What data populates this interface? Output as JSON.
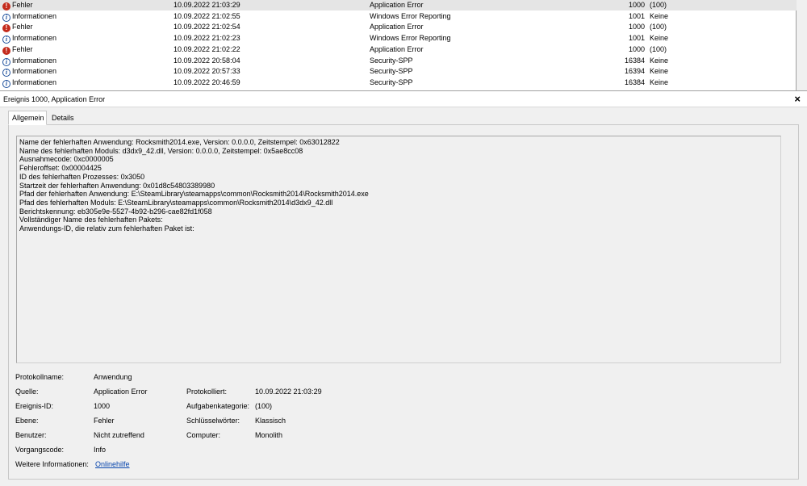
{
  "events": [
    {
      "level": "Fehler",
      "level_type": "error",
      "date": "10.09.2022 21:03:29",
      "source": "Application Error",
      "id": "1000",
      "task": "(100)",
      "selected": true
    },
    {
      "level": "Informationen",
      "level_type": "info",
      "date": "10.09.2022 21:02:55",
      "source": "Windows Error Reporting",
      "id": "1001",
      "task": "Keine"
    },
    {
      "level": "Fehler",
      "level_type": "error",
      "date": "10.09.2022 21:02:54",
      "source": "Application Error",
      "id": "1000",
      "task": "(100)"
    },
    {
      "level": "Informationen",
      "level_type": "info",
      "date": "10.09.2022 21:02:23",
      "source": "Windows Error Reporting",
      "id": "1001",
      "task": "Keine"
    },
    {
      "level": "Fehler",
      "level_type": "error",
      "date": "10.09.2022 21:02:22",
      "source": "Application Error",
      "id": "1000",
      "task": "(100)"
    },
    {
      "level": "Informationen",
      "level_type": "info",
      "date": "10.09.2022 20:58:04",
      "source": "Security-SPP",
      "id": "16384",
      "task": "Keine"
    },
    {
      "level": "Informationen",
      "level_type": "info",
      "date": "10.09.2022 20:57:33",
      "source": "Security-SPP",
      "id": "16394",
      "task": "Keine"
    },
    {
      "level": "Informationen",
      "level_type": "info",
      "date": "10.09.2022 20:46:59",
      "source": "Security-SPP",
      "id": "16384",
      "task": "Keine"
    }
  ],
  "detail": {
    "title": "Ereignis 1000, Application Error",
    "close_glyph": "×",
    "tabs": {
      "general": "Allgemein",
      "details": "Details"
    },
    "description": [
      "Name der fehlerhaften Anwendung: Rocksmith2014.exe, Version: 0.0.0.0, Zeitstempel: 0x63012822",
      "Name des fehlerhaften Moduls: d3dx9_42.dll, Version: 0.0.0.0, Zeitstempel: 0x5ae8cc08",
      "Ausnahmecode: 0xc0000005",
      "Fehleroffset: 0x00004425",
      "ID des fehlerhaften Prozesses: 0x3050",
      "Startzeit der fehlerhaften Anwendung: 0x01d8c54803389980",
      "Pfad der fehlerhaften Anwendung: E:\\SteamLibrary\\steamapps\\common\\Rocksmith2014\\Rocksmith2014.exe",
      "Pfad des fehlerhaften Moduls: E:\\SteamLibrary\\steamapps\\common\\Rocksmith2014\\d3dx9_42.dll",
      "Berichtskennung: eb305e9e-5527-4b92-b296-cae82fd1f058",
      "Vollständiger Name des fehlerhaften Pakets:",
      "Anwendungs-ID, die relativ zum fehlerhaften Paket ist:"
    ],
    "props": {
      "log_name_label": "Protokollname:",
      "log_name": "Anwendung",
      "source_label": "Quelle:",
      "source": "Application Error",
      "logged_label": "Protokolliert:",
      "logged": "10.09.2022 21:03:29",
      "event_id_label": "Ereignis-ID:",
      "event_id": "1000",
      "task_label": "Aufgabenkategorie:",
      "task": "(100)",
      "level_label": "Ebene:",
      "level": "Fehler",
      "keywords_label": "Schlüsselwörter:",
      "keywords": "Klassisch",
      "user_label": "Benutzer:",
      "user": "Nicht zutreffend",
      "computer_label": "Computer:",
      "computer": "Monolith",
      "opcode_label": "Vorgangscode:",
      "opcode": "Info",
      "more_info_label": "Weitere Informationen:",
      "more_info": "Onlinehilfe"
    }
  },
  "colors": {
    "error_icon": "#c42b1c",
    "info_icon": "#1c4f9c",
    "link": "#0645ad",
    "selected_row": "#e5e5e5"
  }
}
